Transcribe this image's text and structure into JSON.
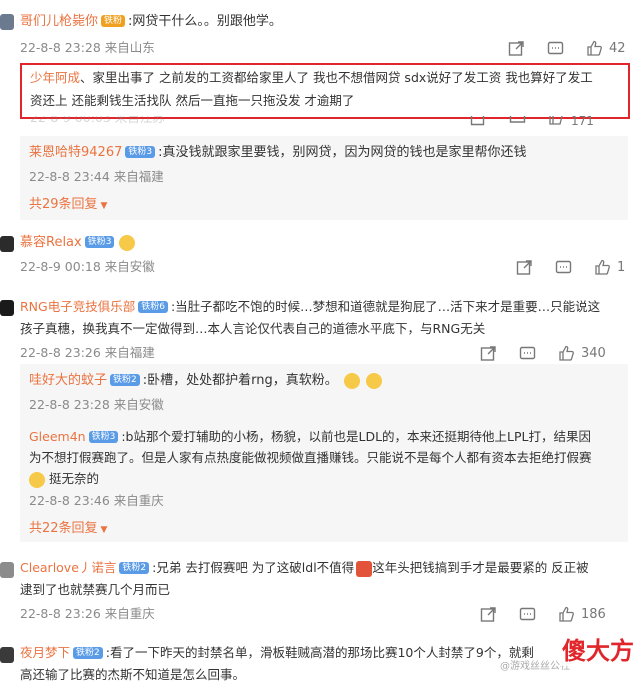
{
  "comments": [
    {
      "user": "哥们儿枪毙你",
      "badge": "铁粉",
      "text": ":网贷干什么。。别跟他学。",
      "time": "22-8-8 23:28 来自山东",
      "likes": "42"
    },
    {
      "highlight_user": "少年阿成",
      "highlight_line1": "、家里出事了 之前发的工资都给家里人了 我也不想借网贷 sdx说好了发工资 我也算好了发工",
      "highlight_line2": "资还上 还能剩钱生活找队 然后一直拖一只拖没发 才逾期了",
      "time_partial": "22-8-9 00:03 来自江苏",
      "likes": "171",
      "reply_user": "莱恩哈特94267",
      "reply_badge": "铁粉3",
      "reply_text": ":真没钱就跟家里要钱，别网贷，因为网贷的钱也是家里帮你还钱",
      "reply_time": "22-8-8 23:44 来自福建",
      "more": "共29条回复"
    },
    {
      "user": "慕容Relax",
      "badge": "铁粉3",
      "time": "22-8-9 00:18 来自安徽",
      "likes": "1"
    },
    {
      "user": "RNG电子竞技俱乐部",
      "badge": "铁粉6",
      "text1": ":当肚子都吃不饱的时候…梦想和道德就是狗屁了…活下来才是重要…只能说这",
      "text2": "孩子真穗，换我真不一定做得到…本人言论仅代表自己的道德水平底下，与RNG无关",
      "time": "22-8-8 23:26 来自福建",
      "likes": "340",
      "replies": [
        {
          "user": "哇好大的蚊子",
          "badge": "铁粉2",
          "text": ":卧槽，处处都护着rng，真软粉。",
          "time": "22-8-8 23:28 来自安徽"
        },
        {
          "user": "Gleem4n",
          "badge": "铁粉3",
          "text1": ":b站那个爱打辅助的小杨，杨貌，以前也是LDL的，本来还挺期待他上LPL打，结果因",
          "text2": "为不想打假赛跑了。但是人家有点热度能做视频做直播赚钱。只能说不是每个人都有资本去拒绝打假赛",
          "text3": "挺无奈的",
          "time": "22-8-8 23:46 来自重庆"
        }
      ],
      "more": "共22条回复"
    },
    {
      "user": "Clearlove丿诺言",
      "badge": "铁粉2",
      "text1": ":兄弟 去打假赛吧 为了这破ldl不值得",
      "text1b": "这年头把钱搞到手才是最要紧的 反正被",
      "text2": "逮到了也就禁赛几个月而已",
      "time": "22-8-8 23:26 来自重庆",
      "likes": "186"
    },
    {
      "user": "夜月梦下",
      "badge": "铁粉2",
      "text1": ":看了一下昨天的封禁名单，滑板鞋贼高潜的那场比赛10个人封禁了9个，就剩",
      "text2": "高还输了比赛的杰斯不知道是怎么回事。"
    }
  ],
  "watermark": {
    "text": "傻大方",
    "faint": "@游戏丝丝公社"
  },
  "colors": {
    "username": "#eb7340",
    "highlight_border": "#e0262a",
    "badge_blue": "#5a9be8",
    "badge_gold": "#f0a020"
  }
}
